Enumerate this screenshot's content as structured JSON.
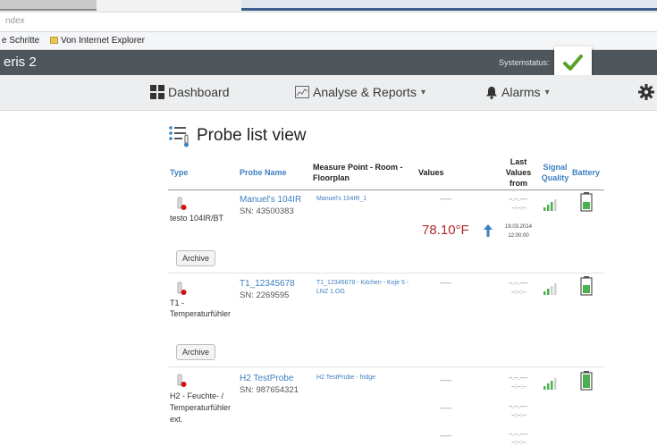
{
  "browser": {
    "address_text": "ndex",
    "favorites": [
      "e Schritte",
      "Von Internet Explorer"
    ]
  },
  "app": {
    "title": "eris 2",
    "system_status_label": "Systemstatus:",
    "status_icon": "checkmark-icon",
    "status_color": "#5aa02c"
  },
  "nav": {
    "dashboard": "Dashboard",
    "analyse": "Analyse & Reports",
    "alarms": "Alarms",
    "caret": "▾"
  },
  "page": {
    "title": "Probe list view"
  },
  "table": {
    "headers": {
      "type": "Type",
      "probe_name": "Probe Name",
      "measure_point": "Measure Point - Room -",
      "floorplan": "Floorplan",
      "values": "Values",
      "last_values_1": "Last",
      "last_values_2": "Values",
      "last_values_3": "from",
      "signal_1": "Signal",
      "signal_2": "Quality",
      "battery": "Battery"
    },
    "rows": [
      {
        "type": "testo 104IR/BT",
        "probe_name": "Manuel's 104IR",
        "sn": "SN: 43500383",
        "measure_point": "Manuel's 104IR_1",
        "value_dash": "------",
        "last_dash_1": "--.--.----",
        "last_dash_2": "--:--:--",
        "big_value": "78.10°F",
        "date": "19.03.2014",
        "time": "12:00:00",
        "archive": "Archive"
      },
      {
        "type_1": "T1 -",
        "type_2": "Temperaturfühler",
        "probe_name": "T1_12345678",
        "sn": "SN: 2269595",
        "measure_point_1": "T1_12345678 - Kitchen - Koje 5 -",
        "measure_point_2": "LNZ 1.OG",
        "value_dash": "------",
        "last_dash_1": "--.--.----",
        "last_dash_2": "--:--:--",
        "archive": "Archive"
      },
      {
        "type_1": "H2 - Feuchte- /",
        "type_2": "Temperaturfühler",
        "type_3": "ext.",
        "probe_name": "H2 TestProbe",
        "sn": "SN: 987654321",
        "measure_point": "H2 TestProbe - fridge",
        "value_dash": "------",
        "last_dash_1": "--.--.----",
        "last_dash_2": "--:--:--"
      }
    ]
  }
}
